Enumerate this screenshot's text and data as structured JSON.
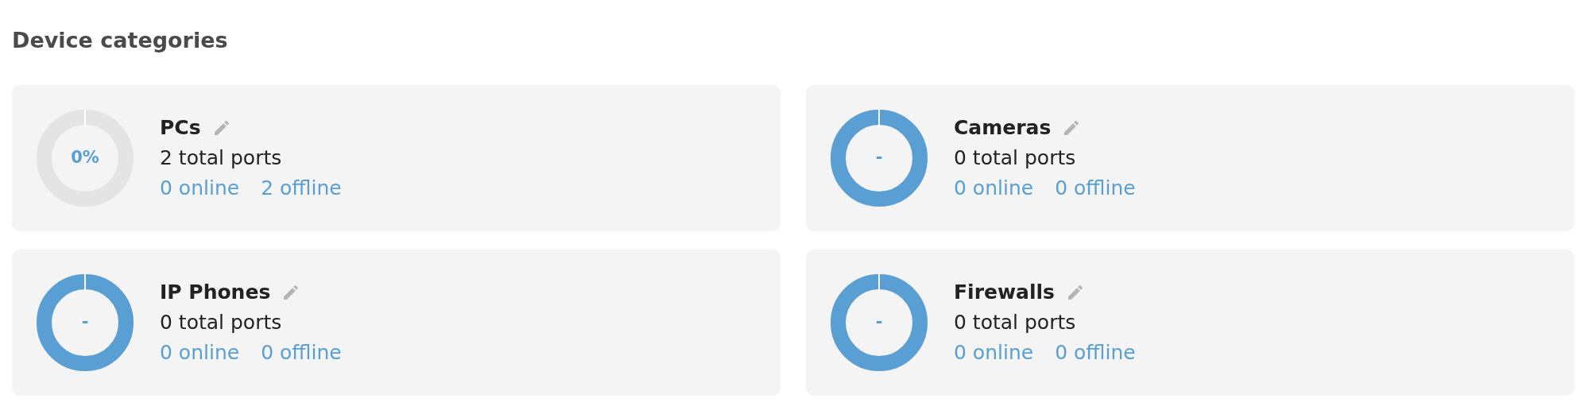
{
  "heading": "Device categories",
  "categories": [
    {
      "name": "PCs",
      "total": "2 total ports",
      "online": "0 online",
      "offline": "2 offline",
      "center": "0%",
      "level": 0
    },
    {
      "name": "Cameras",
      "total": "0 total ports",
      "online": "0 online",
      "offline": "0 offline",
      "center": "-",
      "level": 1
    },
    {
      "name": "IP Phones",
      "total": "0 total ports",
      "online": "0 online",
      "offline": "0 offline",
      "center": "-",
      "level": 1
    },
    {
      "name": "Firewalls",
      "total": "0 total ports",
      "online": "0 online",
      "offline": "0 offline",
      "center": "-",
      "level": 1
    }
  ]
}
